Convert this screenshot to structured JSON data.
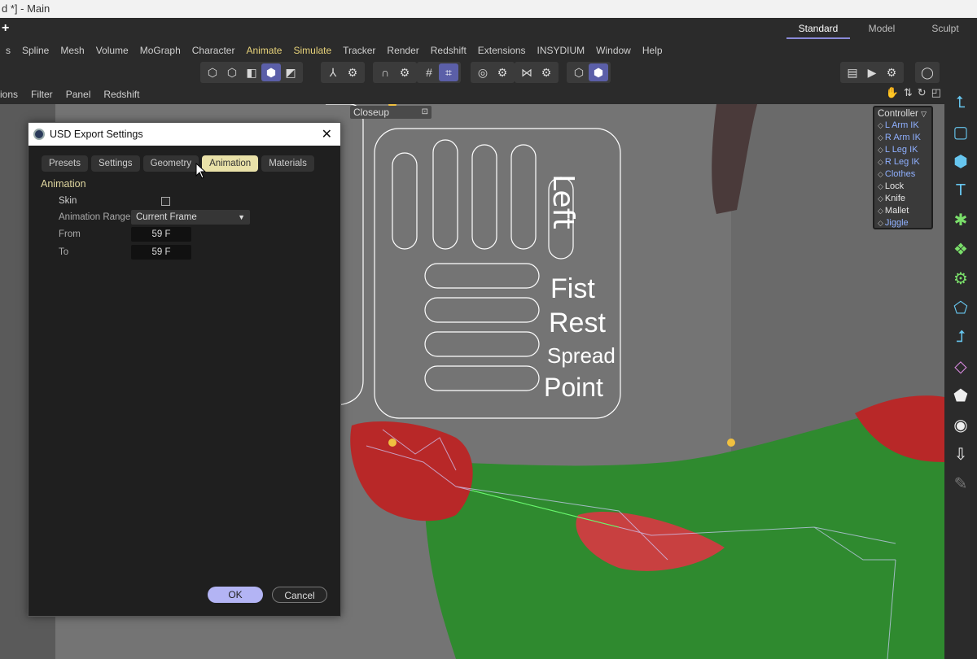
{
  "window": {
    "title": "d *] - Main"
  },
  "layouts": [
    "Standard",
    "Model",
    "Sculpt"
  ],
  "menu": [
    "s",
    "Spline",
    "Mesh",
    "Volume",
    "MoGraph",
    "Character",
    "Animate",
    "Simulate",
    "Tracker",
    "Render",
    "Redshift",
    "Extensions",
    "INSYDIUM",
    "Window",
    "Help"
  ],
  "submenu": [
    "ions",
    "Filter",
    "Panel",
    "Redshift"
  ],
  "viewport": {
    "camera": "Closeup"
  },
  "controller": {
    "title": "Controller",
    "items": [
      {
        "label": "L Arm IK",
        "color": "blue"
      },
      {
        "label": "R Arm IK",
        "color": "blue"
      },
      {
        "label": "L Leg IK",
        "color": "blue"
      },
      {
        "label": "R Leg IK",
        "color": "blue"
      },
      {
        "label": "Clothes",
        "color": "blue"
      },
      {
        "label": "Lock",
        "color": "white"
      },
      {
        "label": "Knife",
        "color": "white"
      },
      {
        "label": "Mallet",
        "color": "white"
      },
      {
        "label": "Jiggle",
        "color": "blue"
      }
    ]
  },
  "rig_panel": {
    "side": "Left",
    "poses": [
      "Fist",
      "Rest",
      "Spread",
      "Point"
    ]
  },
  "dialog": {
    "title": "USD Export Settings",
    "tabs": [
      "Presets",
      "Settings",
      "Geometry",
      "Animation",
      "Materials"
    ],
    "active_tab": "Animation",
    "section": "Animation",
    "skin_label": "Skin",
    "skin_checked": false,
    "range_label": "Animation Range",
    "range_value": "Current Frame",
    "from_label": "From",
    "from_value": "59 F",
    "to_label": "To",
    "to_value": "59 F",
    "ok": "OK",
    "cancel": "Cancel"
  }
}
